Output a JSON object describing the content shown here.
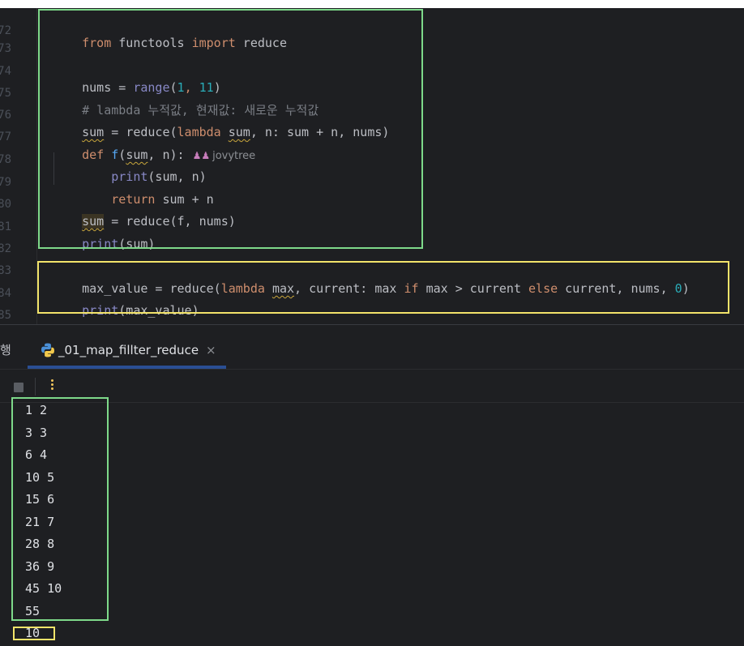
{
  "editor": {
    "line_numbers": [
      "72",
      "73",
      "74",
      "75",
      "76",
      "77",
      "78",
      "79",
      "80",
      "81",
      "82",
      "83",
      "84",
      "85"
    ],
    "code": {
      "l72": {
        "kw1": "from",
        "mod": " functools ",
        "kw2": "import",
        "name": " reduce"
      },
      "l74": {
        "a": "nums = ",
        "b": "range",
        "c": "(",
        "n1": "1",
        "d": ", ",
        "n2": "11",
        "e": ")"
      },
      "l75": {
        "comment": "# lambda 누적값, 현재값: 새로운 누적값"
      },
      "l76": {
        "a": "sum",
        "b": " = ",
        "c": "reduce",
        "d": "(",
        "e": "lambda",
        "f": " ",
        "g": "sum",
        "h": ", n: sum + n, nums)"
      },
      "l77": {
        "a": "def",
        "b": " ",
        "c": "f",
        "d": "(",
        "e": "sum",
        "f": ", n):",
        "inlay_user": "jovytree"
      },
      "l78": {
        "a": "    ",
        "b": "print",
        "c": "(sum, n)"
      },
      "l79": {
        "a": "    ",
        "b": "return",
        "c": " sum + n"
      },
      "l80": {
        "a": "sum",
        "b": " = reduce(f, nums)"
      },
      "l81": {
        "a": "print",
        "b": "(sum)"
      },
      "l83": {
        "a": "max_value = reduce(",
        "b": "lambda",
        "c": " ",
        "d": "max",
        "e": ", current: max ",
        "f": "if",
        "g": " max > current ",
        "h": "else",
        "i": " current, nums, ",
        "j": "0",
        "k": ")"
      },
      "l84": {
        "a": "print",
        "b": "(max_value)"
      }
    }
  },
  "run_panel": {
    "left_label": "행",
    "tab_label": "_01_map_fillter_reduce",
    "close_glyph": "×"
  },
  "console_output": [
    "1 2",
    "3 3",
    "6 4",
    "10 5",
    "15 6",
    "21 7",
    "28 8",
    "36 9",
    "45 10",
    "55",
    "10"
  ],
  "colors": {
    "background": "#1e1f22",
    "keyword": "#cf8e6d",
    "function": "#56a8f5",
    "builtin": "#8888c6",
    "number": "#2aacb8",
    "comment": "#7a7e85",
    "highlight_green": "#7ed98a",
    "highlight_yellow": "#f2e36a"
  },
  "icons": [
    "user-icon",
    "python-file-icon",
    "close-icon",
    "stop-icon",
    "more-vertical-icon"
  ]
}
